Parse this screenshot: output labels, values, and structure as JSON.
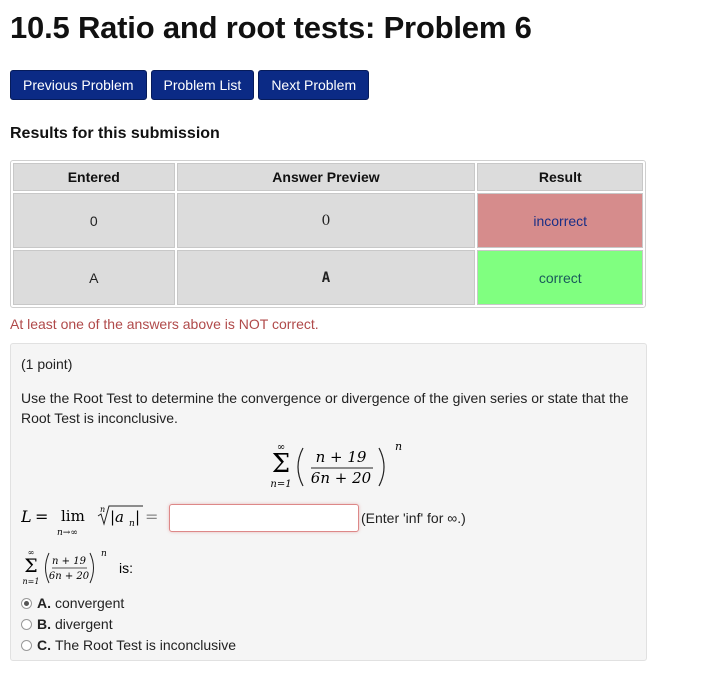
{
  "page": {
    "title": "10.5 Ratio and root tests: Problem 6"
  },
  "nav": {
    "previous": "Previous Problem",
    "list": "Problem List",
    "next": "Next Problem"
  },
  "results": {
    "title": "Results for this submission",
    "headers": [
      "Entered",
      "Answer Preview",
      "Result"
    ],
    "rows": [
      {
        "entered": "0",
        "preview": "0",
        "result": "incorrect",
        "result_color": "#d68c8c"
      },
      {
        "entered": "A",
        "preview": "A",
        "result": "correct",
        "result_color": "#80ff80"
      }
    ],
    "warning": "At least one of the answers above is NOT correct."
  },
  "problem": {
    "points": "(1 point)",
    "statement": "Use the Root Test to determine the convergence or divergence of the given series or state that the Root Test is inconclusive.",
    "series": {
      "sum_upper": "∞",
      "sum_lower": "n=1",
      "numerator": "n + 19",
      "denominator": "6n + 20",
      "exponent": "n"
    },
    "limit": {
      "L": "L",
      "lim": "lim",
      "sub": "n→∞",
      "root_index": "n",
      "term": "|a",
      "term_sub": "n",
      "term_end": "|",
      "equals": "="
    },
    "answer": {
      "value": "",
      "hint": "(Enter 'inf' for ∞.)"
    },
    "series_small_suffix": "is:",
    "options": [
      {
        "letter": "A.",
        "label": "convergent",
        "checked": true
      },
      {
        "letter": "B.",
        "label": "divergent",
        "checked": false
      },
      {
        "letter": "C.",
        "label": "The Root Test is inconclusive",
        "checked": false
      }
    ]
  }
}
